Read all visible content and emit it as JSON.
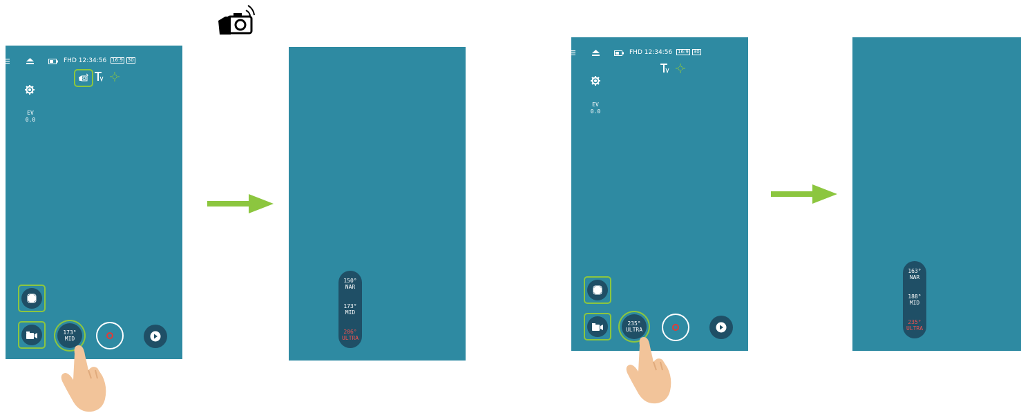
{
  "top_icon": {
    "name": "camera-wave-icon"
  },
  "status": {
    "quality": "FHD",
    "time": "12:34:56",
    "ratio": "16:9",
    "fps": "30"
  },
  "ev": {
    "label": "EV",
    "value": "0.0"
  },
  "screen1": {
    "fov_degree": "173°",
    "fov_label": "MID"
  },
  "screen2": {
    "options": [
      {
        "degree": "150°",
        "label": "NAR"
      },
      {
        "degree": "173°",
        "label": "MID"
      },
      {
        "degree": "206°",
        "label": "ULTRA",
        "active": true
      }
    ]
  },
  "screen3": {
    "fov_degree": "235°",
    "fov_label": "ULTRA"
  },
  "screen4": {
    "options": [
      {
        "degree": "163°",
        "label": "NAR"
      },
      {
        "degree": "188°",
        "label": "MID"
      },
      {
        "degree": "235°",
        "label": "ULTRA",
        "active": true
      }
    ]
  },
  "colors": {
    "screen_bg": "#2e8aa2",
    "highlight": "#8cc63f",
    "arrow": "#8cc63f",
    "active_option": "#ef5350",
    "button_bg": "#1f4f66"
  }
}
